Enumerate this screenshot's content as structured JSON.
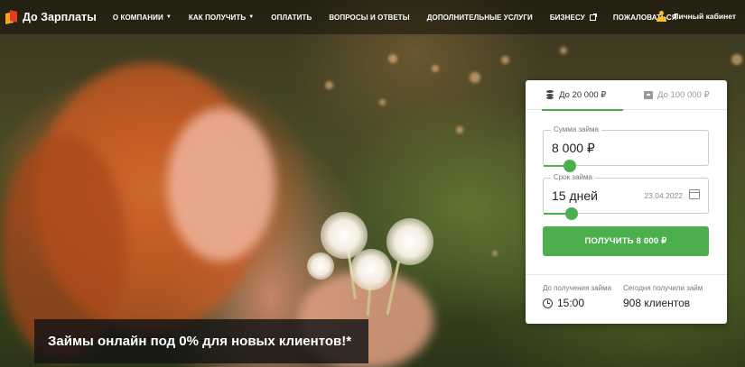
{
  "header": {
    "logo_text": "До Зарплаты",
    "nav": [
      {
        "label": "О компании",
        "has_dropdown": true
      },
      {
        "label": "Как получить",
        "has_dropdown": true
      },
      {
        "label": "Оплатить",
        "has_dropdown": false
      },
      {
        "label": "Вопросы и ответы",
        "has_dropdown": false
      },
      {
        "label": "Дополнительные услуги",
        "has_dropdown": false
      },
      {
        "label": "Бизнесу",
        "has_dropdown": false,
        "external": true
      },
      {
        "label": "Пожаловаться",
        "has_dropdown": false
      }
    ],
    "cabinet_label": "Личный кабинет"
  },
  "hero": {
    "caption": "Займы онлайн под 0% для новых клиентов!*"
  },
  "widget": {
    "tabs": [
      {
        "label": "До 20 000 ₽",
        "active": true,
        "icon": "coins-icon"
      },
      {
        "label": "До 100 000 ₽",
        "active": false,
        "icon": "briefcase-icon"
      }
    ],
    "amount": {
      "label": "Сумма займа",
      "value": "8 000 ₽",
      "slider_fraction": 0.16
    },
    "term": {
      "label": "Срок займа",
      "value": "15 дней",
      "date": "23.04.2022",
      "slider_fraction": 0.17
    },
    "cta_label": "ПОЛУЧИТЬ 8 000 ₽",
    "info": [
      {
        "label": "До получения займа",
        "value": "15:00",
        "icon": "clock-icon"
      },
      {
        "label": "Сегодня получили займ",
        "value": "908 клиентов"
      }
    ]
  },
  "colors": {
    "accent_green": "#4cae4c",
    "user_icon_yellow": "#f6c026",
    "logo_orange": "#f5a623",
    "logo_red": "#e63a24"
  }
}
